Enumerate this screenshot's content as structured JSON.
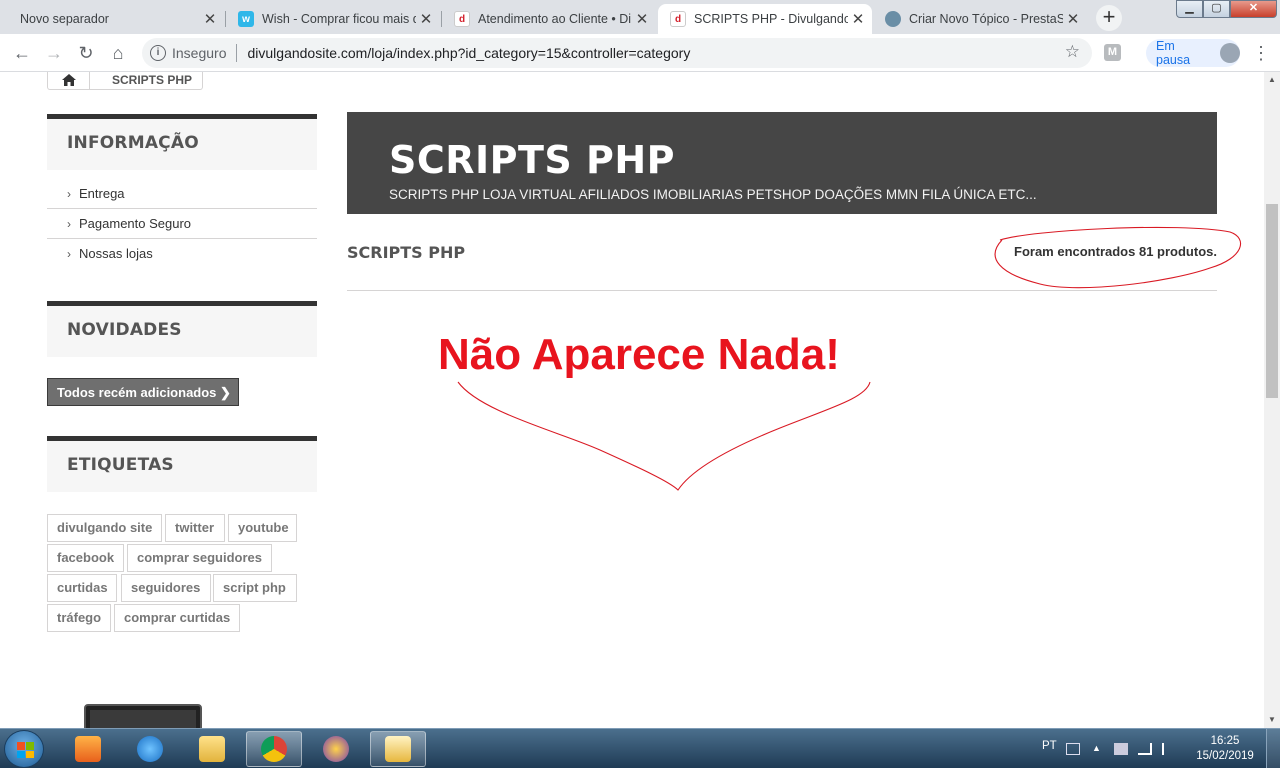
{
  "browser": {
    "tabs": [
      {
        "title": "Novo separador",
        "active": false
      },
      {
        "title": "Wish - Comprar ficou mais d",
        "active": false
      },
      {
        "title": "Atendimento ao Cliente • Di",
        "active": false
      },
      {
        "title": "SCRIPTS PHP - Divulgando S",
        "active": true
      },
      {
        "title": "Criar Novo Tópico - PrestaSh",
        "active": false
      }
    ],
    "close_glyph": "✕",
    "new_tab_glyph": "+",
    "address": {
      "security_label": "Inseguro",
      "url": "divulgandosite.com/loja/index.php?id_category=15&controller=category"
    },
    "profile_status": "Em pausa",
    "icons": {
      "back": "arrow-left-icon",
      "forward": "arrow-right-icon",
      "reload": "reload-icon",
      "home": "home-icon",
      "bookmark": "star-icon",
      "menu": "more-vert-icon"
    }
  },
  "breadcrumb": {
    "home_icon": "home-icon",
    "current": "SCRIPTS PHP"
  },
  "sidebar": {
    "information": {
      "title": "INFORMAÇÃO",
      "items": [
        {
          "label": "Entrega"
        },
        {
          "label": "Pagamento Seguro"
        },
        {
          "label": "Nossas lojas"
        }
      ]
    },
    "new_products": {
      "title": "NOVIDADES",
      "button_label": "Todos recém adicionados"
    },
    "tags": {
      "title": "ETIQUETAS",
      "items": [
        "divulgando site",
        "twitter",
        "youtube",
        "facebook",
        "comprar seguidores",
        "curtidas",
        "seguidores",
        "script php",
        "tráfego",
        "comprar curtidas"
      ]
    }
  },
  "category": {
    "banner_title": "SCRIPTS PHP",
    "banner_description": "SCRIPTS PHP LOJA VIRTUAL AFILIADOS IMOBILIARIAS PETSHOP DOAÇÕES MMN FILA ÚNICA ETC...",
    "heading": "SCRIPTS PHP",
    "product_count_text": "Foram encontrados 81 produtos."
  },
  "annotation": {
    "text": "Não Aparece Nada!",
    "color": "#e8141e"
  },
  "taskbar": {
    "language": "PT",
    "time": "16:25",
    "date": "15/02/2019",
    "apps": [
      "media-player-icon",
      "internet-explorer-icon",
      "file-explorer-icon",
      "chrome-icon",
      "browser-shield-icon",
      "outlook-icon"
    ]
  }
}
